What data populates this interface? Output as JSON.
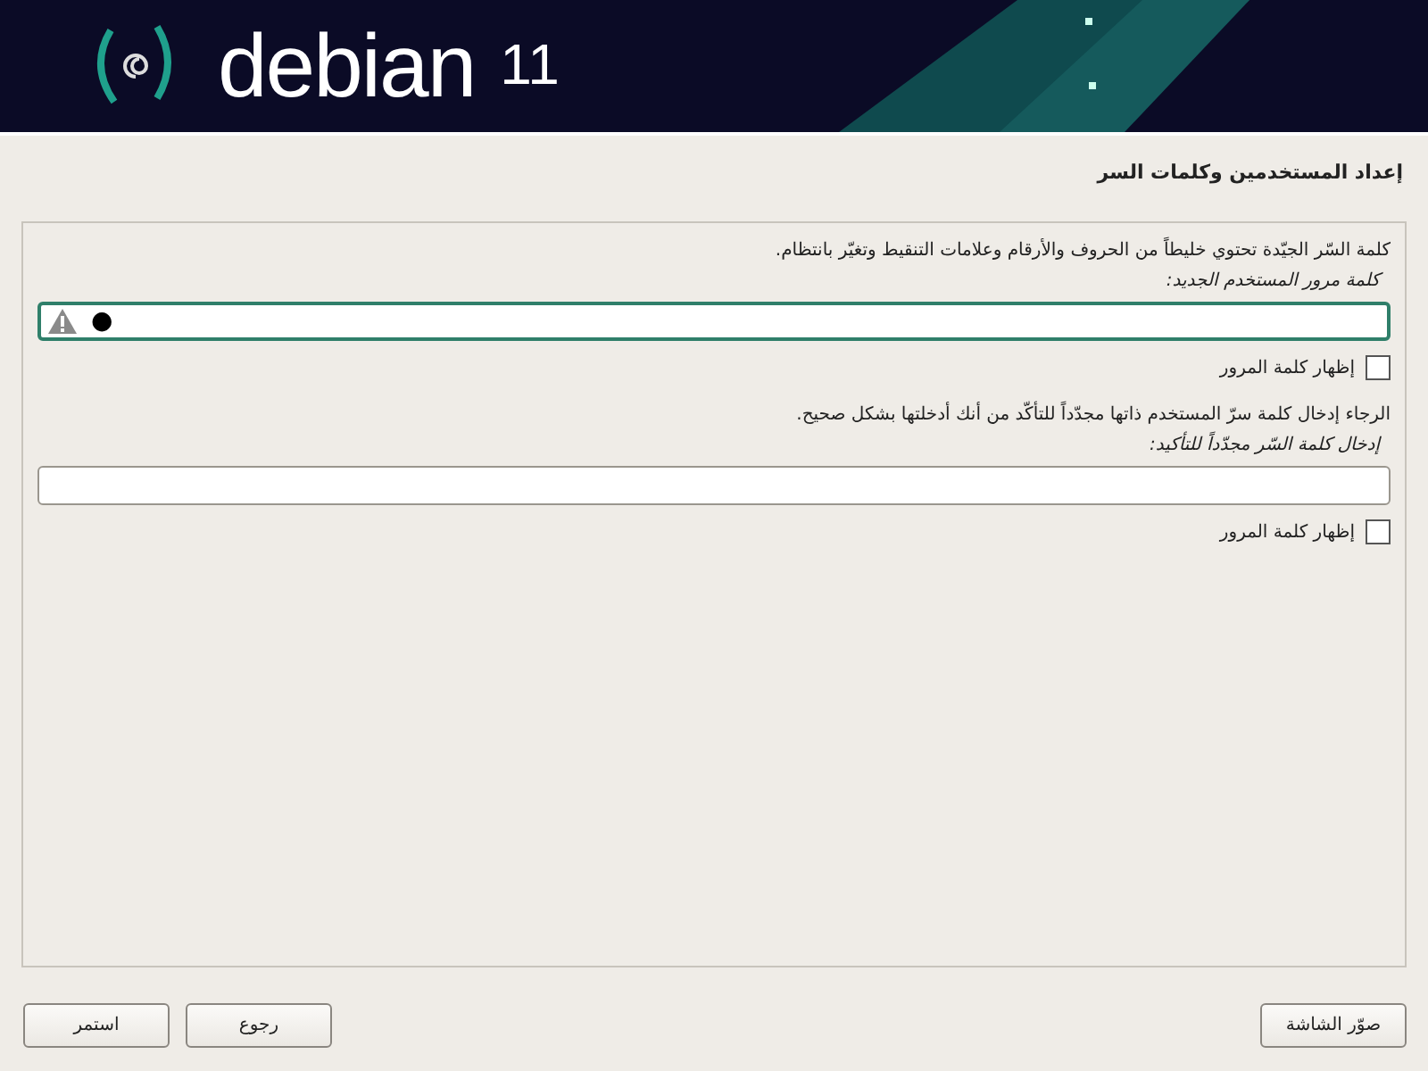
{
  "banner": {
    "logo_text": "debian",
    "version": "11"
  },
  "page_title": "إعداد المستخدمين وكلمات السر",
  "sections": [
    {
      "hint": "كلمة السّر الجيّدة تحتوي خليطاً من الحروف والأرقام وعلامات التنقيط وتغيّر بانتظام.",
      "label": "كلمة مرور المستخدم الجديد:",
      "value": "●",
      "warning": true,
      "focused": true,
      "show_password": {
        "label": "إظهار كلمة المرور",
        "checked": false
      }
    },
    {
      "hint": "الرجاء إدخال كلمة سرّ المستخدم ذاتها مجدّداً للتأكّد من أنك أدخلتها بشكل صحيح.",
      "label": "إدخال كلمة السّر مجدّداً للتأكيد:",
      "warning": false,
      "focused": false,
      "show_password": {
        "label": "إظهار كلمة المرور",
        "checked": false
      }
    }
  ],
  "buttons": [
    {
      "label": "صوّر الشاشة",
      "kind": "screenshot"
    },
    {
      "label": "رجوع",
      "kind": "back"
    },
    {
      "label": "استمر",
      "kind": "continue"
    }
  ]
}
